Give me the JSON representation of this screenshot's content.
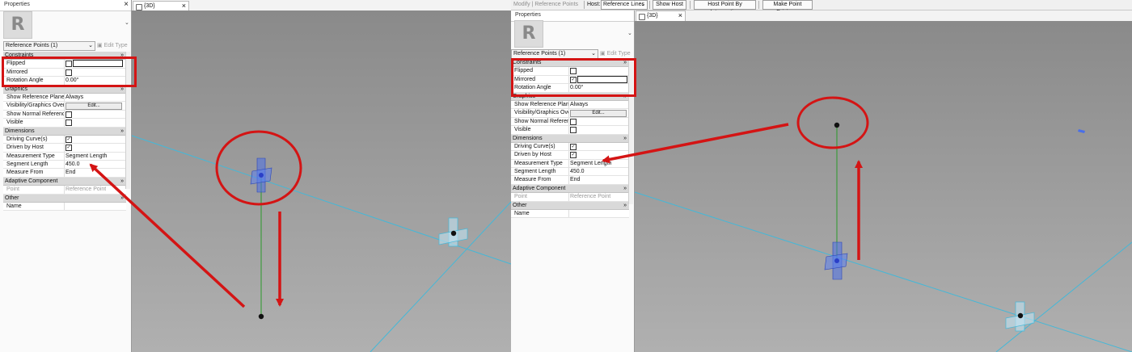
{
  "left": {
    "properties_title": "Properties",
    "type_selector": "Reference Points (1)",
    "edit_type": "Edit Type",
    "view_tab": "{3D}",
    "sections": [
      {
        "header": "Constraints",
        "rows": [
          {
            "label": "Flipped",
            "kind": "checkbox",
            "checked": false,
            "boxed": true
          },
          {
            "label": "Mirrored",
            "kind": "checkbox",
            "checked": false
          },
          {
            "label": "Rotation Angle",
            "kind": "text",
            "value": "0.00°"
          }
        ]
      },
      {
        "header": "Graphics",
        "rows": [
          {
            "label": "Show Reference Planes",
            "kind": "text",
            "value": "Always"
          },
          {
            "label": "Visibility/Graphics Over...",
            "kind": "button",
            "value": "Edit..."
          },
          {
            "label": "Show Normal Referenc...",
            "kind": "checkbox",
            "checked": false
          },
          {
            "label": "Visible",
            "kind": "checkbox",
            "checked": false
          }
        ]
      },
      {
        "header": "Dimensions",
        "rows": [
          {
            "label": "Driving Curve(s)",
            "kind": "checkbox",
            "checked": true
          },
          {
            "label": "Driven by Host",
            "kind": "checkbox",
            "checked": true
          },
          {
            "label": "Measurement Type",
            "kind": "text",
            "value": "Segment Length"
          },
          {
            "label": "Segment Length",
            "kind": "text",
            "value": "450.0"
          },
          {
            "label": "Measure From",
            "kind": "text",
            "value": "End"
          }
        ]
      },
      {
        "header": "Adaptive Component",
        "rows": [
          {
            "label": "Point",
            "kind": "text",
            "value": "Reference Point",
            "grey": true
          }
        ]
      },
      {
        "header": "Other",
        "rows": [
          {
            "label": "Name",
            "kind": "text",
            "value": ""
          }
        ]
      }
    ]
  },
  "right": {
    "context_label": "Modify | Reference Points",
    "host_label": "Host:",
    "host_value": "Reference Lines",
    "buttons": [
      "Show Host",
      "Host Point By Intersection",
      "Make Point Driving..."
    ],
    "properties_title": "Properties",
    "type_selector": "Reference Points (1)",
    "edit_type": "Edit Type",
    "view_tab": "{3D}",
    "sections": [
      {
        "header": "Constraints",
        "rows": [
          {
            "label": "Flipped",
            "kind": "checkbox",
            "checked": false
          },
          {
            "label": "Mirrored",
            "kind": "checkbox",
            "checked": true,
            "boxed": true
          },
          {
            "label": "Rotation Angle",
            "kind": "text",
            "value": "0.00°"
          }
        ]
      },
      {
        "header": "Graphics",
        "rows": [
          {
            "label": "Show Reference Planes",
            "kind": "text",
            "value": "Always"
          },
          {
            "label": "Visibility/Graphics Over...",
            "kind": "button",
            "value": "Edit..."
          },
          {
            "label": "Show Normal Referenc...",
            "kind": "checkbox",
            "checked": false
          },
          {
            "label": "Visible",
            "kind": "checkbox",
            "checked": false
          }
        ]
      },
      {
        "header": "Dimensions",
        "rows": [
          {
            "label": "Driving Curve(s)",
            "kind": "checkbox",
            "checked": true
          },
          {
            "label": "Driven by Host",
            "kind": "checkbox",
            "checked": true
          },
          {
            "label": "Measurement Type",
            "kind": "text",
            "value": "Segment Length"
          },
          {
            "label": "Segment Length",
            "kind": "text",
            "value": "450.0"
          },
          {
            "label": "Measure From",
            "kind": "text",
            "value": "End"
          }
        ]
      },
      {
        "header": "Adaptive Component",
        "rows": [
          {
            "label": "Point",
            "kind": "text",
            "value": "Reference Point",
            "grey": true
          }
        ]
      },
      {
        "header": "Other",
        "rows": [
          {
            "label": "Name",
            "kind": "text",
            "value": ""
          }
        ]
      }
    ]
  },
  "icons": {
    "logo": "R",
    "close": "×",
    "collapse": "»",
    "dropdown": "⌄"
  },
  "colors": {
    "annotation_red": "#d41414",
    "reference_line": "#44b8d8",
    "curve_green": "#2a9a2a",
    "point_blue": "#3a5fd8"
  }
}
